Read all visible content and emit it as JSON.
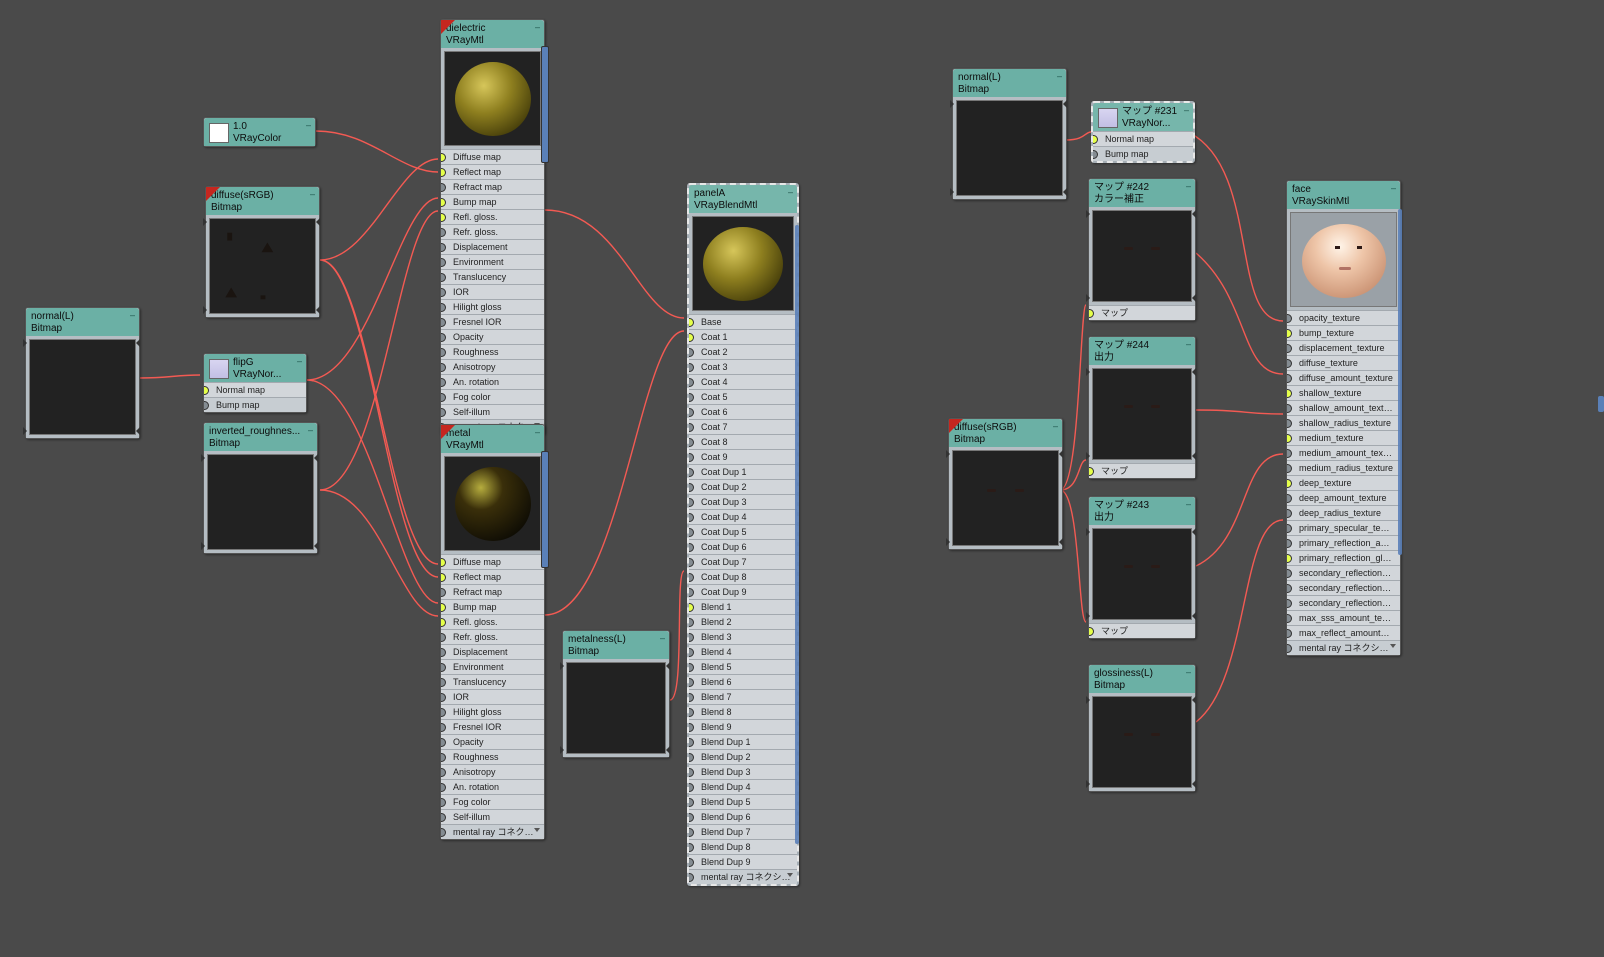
{
  "nodes": {
    "normalL_left": {
      "title": "normal(L)",
      "subtitle": "Bitmap"
    },
    "vraycolor": {
      "title": "1.0",
      "subtitle": "VRayColor"
    },
    "diffuse_srgb_l": {
      "title": "diffuse(sRGB)",
      "subtitle": "Bitmap"
    },
    "flipG": {
      "title": "flipG",
      "subtitle": "VRayNor..."
    },
    "flipG_slots": [
      "Normal map",
      "Bump map"
    ],
    "inv_rough": {
      "title": "inverted_roughnes...",
      "subtitle": "Bitmap"
    },
    "dielectric": {
      "title": "dielectric",
      "subtitle": "VRayMtl"
    },
    "metal": {
      "title": "metal",
      "subtitle": "VRayMtl"
    },
    "vraymtl_slots": [
      "Diffuse map",
      "Reflect map",
      "Refract map",
      "Bump map",
      "Refl. gloss.",
      "Refr. gloss.",
      "Displacement",
      "Environment",
      "Translucency",
      "IOR",
      "Hilight gloss",
      "Fresnel IOR",
      "Opacity",
      "Roughness",
      "Anisotropy",
      "An. rotation",
      "Fog color",
      "Self-illum",
      "mental ray コネクション"
    ],
    "metalness": {
      "title": "metalness(L)",
      "subtitle": "Bitmap"
    },
    "panelA": {
      "title": "panelA",
      "subtitle": "VRayBlendMtl"
    },
    "panelA_slots": [
      "Base",
      "Coat 1",
      "Coat 2",
      "Coat 3",
      "Coat 4",
      "Coat 5",
      "Coat 6",
      "Coat 7",
      "Coat 8",
      "Coat 9",
      "Coat Dup 1",
      "Coat Dup 2",
      "Coat Dup 3",
      "Coat Dup 4",
      "Coat Dup 5",
      "Coat Dup 6",
      "Coat Dup 7",
      "Coat Dup 8",
      "Coat Dup 9",
      "Blend 1",
      "Blend 2",
      "Blend 3",
      "Blend 4",
      "Blend 5",
      "Blend 6",
      "Blend 7",
      "Blend 8",
      "Blend 9",
      "Blend Dup 1",
      "Blend Dup 2",
      "Blend Dup 3",
      "Blend Dup 4",
      "Blend Dup 5",
      "Blend Dup 6",
      "Blend Dup 7",
      "Blend Dup 8",
      "Blend Dup 9",
      "mental ray コネクション"
    ],
    "normalL_right": {
      "title": "normal(L)",
      "subtitle": "Bitmap"
    },
    "map231": {
      "title": "マップ #231",
      "subtitle": "VRayNor..."
    },
    "map231_slots": [
      "Normal map",
      "Bump map"
    ],
    "map242": {
      "title": "マップ #242",
      "subtitle": "カラー補正"
    },
    "map244": {
      "title": "マップ #244",
      "subtitle": "出力"
    },
    "map243": {
      "title": "マップ #243",
      "subtitle": "出力"
    },
    "mapSlot": "マップ",
    "diffuse_srgb_r": {
      "title": "diffuse(sRGB)",
      "subtitle": "Bitmap"
    },
    "glossiness": {
      "title": "glossiness(L)",
      "subtitle": "Bitmap"
    },
    "face": {
      "title": "face",
      "subtitle": "VRaySkinMtl"
    },
    "face_slots": [
      "opacity_texture",
      "bump_texture",
      "displacement_texture",
      "diffuse_texture",
      "diffuse_amount_texture",
      "shallow_texture",
      "shallow_amount_texture",
      "shallow_radius_texture",
      "medium_texture",
      "medium_amount_texture",
      "medium_radius_texture",
      "deep_texture",
      "deep_amount_texture",
      "deep_radius_texture",
      "primary_specular_texture",
      "primary_reflection_amou...",
      "primary_reflection_glossi...",
      "secondary_reflection_tex...",
      "secondary_reflection_am...",
      "secondary_reflection_glo...",
      "max_sss_amount_texture",
      "max_reflect_amount_text...",
      "mental ray コネクション"
    ]
  },
  "dielectric_connected": [
    1,
    1,
    0,
    1,
    1,
    0,
    0,
    0,
    0,
    0,
    0,
    0,
    0,
    0,
    0,
    0,
    0,
    0,
    0
  ],
  "metal_connected": [
    1,
    1,
    0,
    1,
    1,
    0,
    0,
    0,
    0,
    0,
    0,
    0,
    0,
    0,
    0,
    0,
    0,
    0,
    0
  ],
  "panelA_connected": [
    1,
    1,
    0,
    0,
    0,
    0,
    0,
    0,
    0,
    0,
    0,
    0,
    0,
    0,
    0,
    0,
    0,
    0,
    0,
    1,
    0,
    0,
    0,
    0,
    0,
    0,
    0,
    0,
    0,
    0,
    0,
    0,
    0,
    0,
    0,
    0,
    0,
    0
  ],
  "face_connected": [
    0,
    1,
    0,
    0,
    0,
    1,
    0,
    0,
    1,
    0,
    0,
    1,
    0,
    0,
    0,
    0,
    1,
    0,
    0,
    0,
    0,
    0,
    0
  ],
  "flipG_connected": [
    1,
    0
  ],
  "map231_connected": [
    1,
    0
  ]
}
